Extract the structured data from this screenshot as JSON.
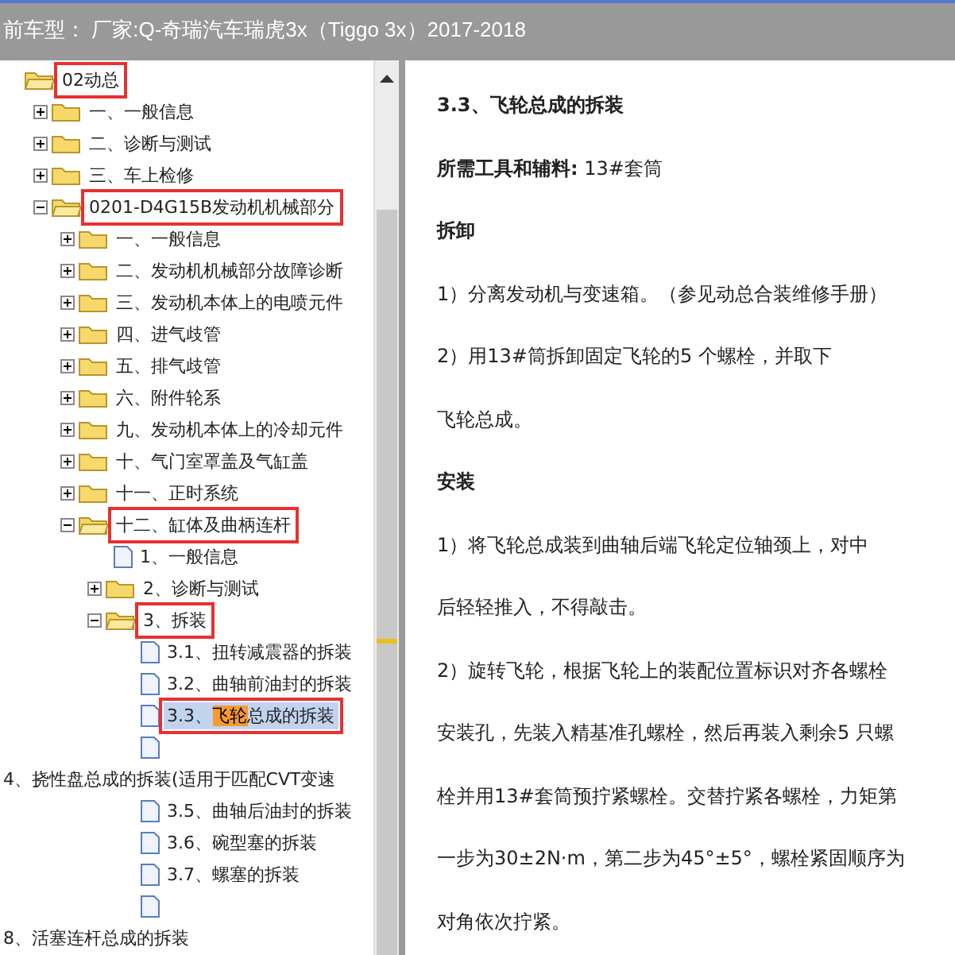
{
  "title_bar": {
    "title": "前车型： 厂家:Q-奇瑞汽车瑞虎3x（Tiggo 3x）2017-2018"
  },
  "tree": [
    {
      "kind": "folder",
      "label": "02动总",
      "expanded": true,
      "highlighted": true,
      "selected": false,
      "children": [
        {
          "kind": "folder",
          "label": "一、一般信息",
          "expanded": false,
          "highlighted": false,
          "selected": false
        },
        {
          "kind": "folder",
          "label": "二、诊断与测试",
          "expanded": false,
          "highlighted": false,
          "selected": false
        },
        {
          "kind": "folder",
          "label": "三、车上检修",
          "expanded": false,
          "highlighted": false,
          "selected": false
        },
        {
          "kind": "folder",
          "label": "0201-D4G15B发动机机械部分",
          "expanded": true,
          "highlighted": true,
          "selected": false,
          "children": [
            {
              "kind": "folder",
              "label": "一、一般信息",
              "expanded": false,
              "highlighted": false,
              "selected": false
            },
            {
              "kind": "folder",
              "label": "二、发动机机械部分故障诊断",
              "expanded": false,
              "highlighted": false,
              "selected": false
            },
            {
              "kind": "folder",
              "label": "三、发动机本体上的电喷元件",
              "expanded": false,
              "highlighted": false,
              "selected": false
            },
            {
              "kind": "folder",
              "label": "四、进气歧管",
              "expanded": false,
              "highlighted": false,
              "selected": false
            },
            {
              "kind": "folder",
              "label": "五、排气歧管",
              "expanded": false,
              "highlighted": false,
              "selected": false
            },
            {
              "kind": "folder",
              "label": "六、附件轮系",
              "expanded": false,
              "highlighted": false,
              "selected": false
            },
            {
              "kind": "folder",
              "label": "九、发动机本体上的冷却元件",
              "expanded": false,
              "highlighted": false,
              "selected": false
            },
            {
              "kind": "folder",
              "label": "十、气门室罩盖及气缸盖",
              "expanded": false,
              "highlighted": false,
              "selected": false
            },
            {
              "kind": "folder",
              "label": "十一、正时系统",
              "expanded": false,
              "highlighted": false,
              "selected": false
            },
            {
              "kind": "folder",
              "label": "十二、缸体及曲柄连杆",
              "expanded": true,
              "highlighted": true,
              "selected": false,
              "children": [
                {
                  "kind": "doc",
                  "label": "1、一般信息",
                  "highlighted": false,
                  "selected": false
                },
                {
                  "kind": "folder",
                  "label": "2、诊断与测试",
                  "expanded": false,
                  "highlighted": false,
                  "selected": false
                },
                {
                  "kind": "folder",
                  "label": "3、拆装",
                  "expanded": true,
                  "highlighted": true,
                  "selected": false,
                  "children": [
                    {
                      "kind": "doc",
                      "label": "3.1、扭转减震器的拆装",
                      "highlighted": false,
                      "selected": false
                    },
                    {
                      "kind": "doc",
                      "label": "3.2、曲轴前油封的拆装",
                      "highlighted": false,
                      "selected": false
                    },
                    {
                      "kind": "doc",
                      "segments": [
                        {
                          "text": "3.3、",
                          "match": false
                        },
                        {
                          "text": "飞轮",
                          "match": true
                        },
                        {
                          "text": "总成的拆装",
                          "match": false
                        }
                      ],
                      "highlighted": true,
                      "selected": true
                    },
                    {
                      "kind": "blank"
                    },
                    {
                      "kind": "stray",
                      "label": "4、挠性盘总成的拆装(适用于匹配CVT变速"
                    },
                    {
                      "kind": "doc",
                      "label": "3.5、曲轴后油封的拆装",
                      "highlighted": false,
                      "selected": false
                    },
                    {
                      "kind": "doc",
                      "label": "3.6、碗型塞的拆装",
                      "highlighted": false,
                      "selected": false
                    },
                    {
                      "kind": "doc",
                      "label": "3.7、螺塞的拆装",
                      "highlighted": false,
                      "selected": false
                    },
                    {
                      "kind": "blank"
                    },
                    {
                      "kind": "stray",
                      "label": "8、活塞连杆总成的拆装"
                    }
                  ]
                }
              ]
            }
          ]
        }
      ]
    }
  ],
  "document": [
    {
      "kind": "heading",
      "text": "3.3、飞轮总成的拆装"
    },
    {
      "kind": "para",
      "text": "**所需工具和辅料:** 13#套筒"
    },
    {
      "kind": "heading",
      "text": "拆卸"
    },
    {
      "kind": "para",
      "text": "1）分离发动机与变速箱。（参见动总合装维修手册）"
    },
    {
      "kind": "para",
      "text": "2）用13#筒拆卸固定飞轮的5 个螺栓，并取下"
    },
    {
      "kind": "para",
      "text": "飞轮总成。"
    },
    {
      "kind": "heading",
      "text": "安装"
    },
    {
      "kind": "para",
      "text": "1）将飞轮总成装到曲轴后端飞轮定位轴颈上，对中"
    },
    {
      "kind": "para",
      "text": "后轻轻推入，不得敲击。"
    },
    {
      "kind": "para",
      "text": "2）旋转飞轮，根据飞轮上的装配位置标识对齐各螺栓"
    },
    {
      "kind": "para",
      "text": "安装孔，先装入精基准孔螺栓，然后再装入剩余5 只螺"
    },
    {
      "kind": "para",
      "text": "栓并用13#套筒预拧紧螺栓。交替拧紧各螺栓，力矩第"
    },
    {
      "kind": "para",
      "text": "一步为30±2N·m，第二步为45°±5°，螺栓紧固顺序为"
    },
    {
      "kind": "para",
      "text": "对角依次拧紧。"
    }
  ]
}
